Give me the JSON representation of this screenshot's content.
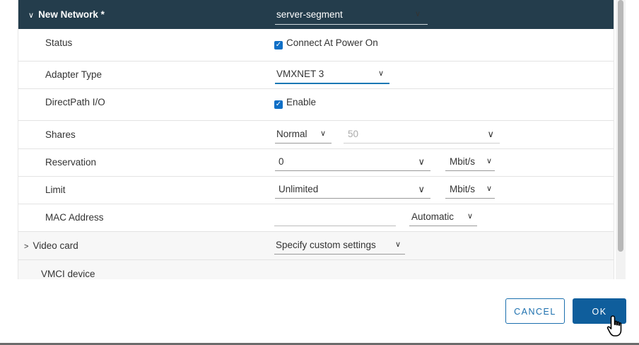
{
  "network": {
    "title": "New Network *",
    "network_value": "server-segment",
    "status_label": "Status",
    "status_checkbox": "Connect At Power On",
    "adapter_label": "Adapter Type",
    "adapter_value": "VMXNET 3",
    "directpath_label": "DirectPath I/O",
    "directpath_checkbox": "Enable",
    "shares_label": "Shares",
    "shares_level": "Normal",
    "shares_value": "50",
    "reservation_label": "Reservation",
    "reservation_value": "0",
    "reservation_unit": "Mbit/s",
    "limit_label": "Limit",
    "limit_value": "Unlimited",
    "limit_unit": "Mbit/s",
    "mac_label": "MAC Address",
    "mac_value": "",
    "mac_mode": "Automatic"
  },
  "video": {
    "label": "Video card",
    "value": "Specify custom settings"
  },
  "vmci": {
    "label": "VMCI device"
  },
  "buttons": {
    "cancel": "CANCEL",
    "ok": "OK"
  },
  "colors": {
    "header_bg": "#243d4c",
    "primary": "#0f5e9c",
    "focus": "#1b78b4"
  }
}
